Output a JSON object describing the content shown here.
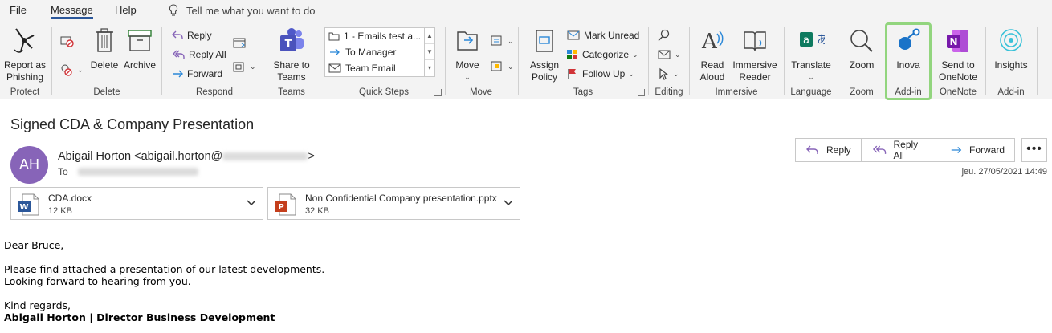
{
  "menu": {
    "tabs": [
      {
        "label": "File"
      },
      {
        "label": "Message"
      },
      {
        "label": "Help"
      }
    ],
    "tell_me": "Tell me what you want to do"
  },
  "ribbon": {
    "protect": {
      "label": "Protect",
      "report": "Report as Phishing"
    },
    "delete": {
      "label": "Delete",
      "delete": "Delete",
      "archive": "Archive"
    },
    "respond": {
      "label": "Respond",
      "reply": "Reply",
      "reply_all": "Reply All",
      "forward": "Forward"
    },
    "teams": {
      "label": "Teams",
      "share": "Share to Teams"
    },
    "quick_steps": {
      "label": "Quick Steps",
      "items": [
        "1 - Emails test a...",
        "To Manager",
        "Team Email"
      ]
    },
    "move": {
      "label": "Move",
      "move": "Move"
    },
    "tags": {
      "label": "Tags",
      "assign": "Assign Policy",
      "mark_unread": "Mark Unread",
      "categorize": "Categorize",
      "follow_up": "Follow Up"
    },
    "editing": {
      "label": "Editing"
    },
    "immersive": {
      "label": "Immersive",
      "read_aloud": "Read Aloud",
      "reader": "Immersive Reader"
    },
    "language": {
      "label": "Language",
      "translate": "Translate"
    },
    "zoom": {
      "label": "Zoom",
      "zoom": "Zoom"
    },
    "addin_inova": {
      "label": "Add-in",
      "inova": "Inova"
    },
    "onenote": {
      "label": "OneNote",
      "send": "Send to OneNote"
    },
    "addin_insights": {
      "label": "Add-in",
      "insights": "Insights"
    }
  },
  "message": {
    "subject": "Signed CDA & Company Presentation",
    "avatar_initials": "AH",
    "avatar_color": "#8764b8",
    "sender_name": "Abigail Horton <abigail.horton@",
    "sender_suffix": ">",
    "to_label": "To",
    "date": "jeu. 27/05/2021 14:49",
    "actions": {
      "reply": "Reply",
      "reply_all": "Reply All",
      "forward": "Forward",
      "more": "•••"
    },
    "attachments": [
      {
        "name": "CDA.docx",
        "size": "12 KB"
      },
      {
        "name": "Non Confidential Company presentation.pptx",
        "size": "32 KB"
      }
    ],
    "body": {
      "greeting": "Dear Bruce,",
      "line1": "Please find attached a presentation of our latest developments.",
      "line2": "Looking forward to hearing from you.",
      "closing": "Kind regards,",
      "signature": "Abigail Horton | Director Business Development"
    }
  },
  "colors": {
    "accent": "#2b579a",
    "highlight": "#92d57e"
  }
}
